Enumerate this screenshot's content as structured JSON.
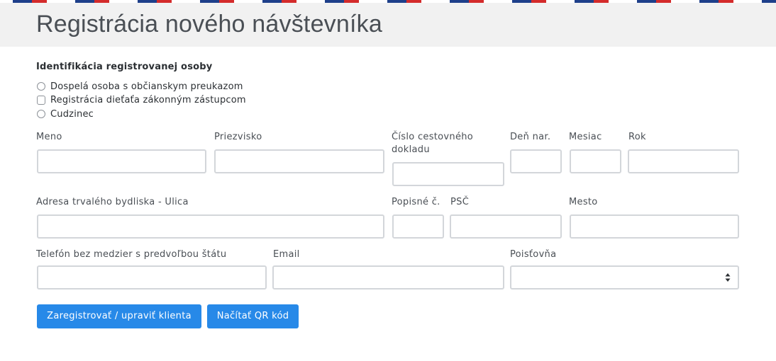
{
  "header": {
    "title": "Registrácia nového návštevníka"
  },
  "identification": {
    "title": "Identifikácia registrovanej osoby",
    "options": [
      "Dospelá osoba s občianskym preukazom",
      "Registrácia dieťaťa zákonným zástupcom",
      "Cudzinec"
    ]
  },
  "fields": {
    "first_name": {
      "label": "Meno",
      "value": ""
    },
    "last_name": {
      "label": "Priezvisko",
      "value": ""
    },
    "passport_number": {
      "label": "Číslo cestovného dokladu",
      "value": ""
    },
    "birth_day": {
      "label": "Deň nar.",
      "value": ""
    },
    "birth_month": {
      "label": "Mesiac",
      "value": ""
    },
    "birth_year": {
      "label": "Rok",
      "value": ""
    },
    "street": {
      "label": "Adresa trvalého bydliska - Ulica",
      "value": ""
    },
    "house_number": {
      "label": "Popisné č.",
      "value": ""
    },
    "postal_code": {
      "label": "PSČ",
      "value": ""
    },
    "city": {
      "label": "Mesto",
      "value": ""
    },
    "phone": {
      "label": "Telefón bez medzier s predvoľbou štátu",
      "value": ""
    },
    "email": {
      "label": "Email",
      "value": ""
    },
    "insurer": {
      "label": "Poisťovňa",
      "value": ""
    }
  },
  "actions": {
    "register": "Zaregistrovať / upraviť klienta",
    "scan_qr": "Načítať QR kód"
  },
  "colors": {
    "primary": "#2789e8",
    "header_bg": "#f1f1f1",
    "input_border": "#d3d6da",
    "stripe_blue": "#1e3f8a",
    "stripe_red": "#d42b2b"
  }
}
